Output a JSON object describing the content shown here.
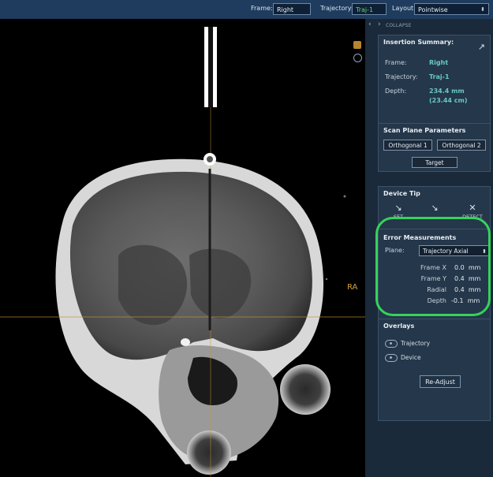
{
  "topbar": {
    "frame_label": "Frame:",
    "frame_value": "Right",
    "trajectory_label": "Trajectory:",
    "trajectory_value": "Traj-1",
    "layout_label": "Layout:",
    "layout_value": "Pointwise"
  },
  "viewer": {
    "orientation_label": "RA",
    "tools": [
      "settings-square-icon",
      "circle-target-icon"
    ]
  },
  "panel": {
    "collapse_label": "COLLAPSE",
    "insertion_summary": {
      "title": "Insertion Summary:",
      "rows": [
        {
          "key": "Frame:",
          "value": "Right"
        },
        {
          "key": "Trajectory:",
          "value": "Traj-1"
        },
        {
          "key": "Depth:",
          "value": "234.4 mm"
        }
      ],
      "depth_secondary": "(23.44 cm)"
    },
    "scan_plane": {
      "title": "Scan Plane Parameters",
      "buttons": [
        "Orthogonal 1",
        "Orthogonal 2"
      ],
      "target_label": "Target"
    },
    "device_tip": {
      "title": "Device Tip",
      "actions": [
        "SET",
        "",
        "DETECT"
      ]
    },
    "error_measurements": {
      "title": "Error Measurements",
      "plane_label": "Plane:",
      "plane_value": "Trajectory Axial",
      "rows": [
        {
          "key": "Frame X",
          "value": "0.0",
          "unit": "mm"
        },
        {
          "key": "Frame Y",
          "value": "0.4",
          "unit": "mm"
        },
        {
          "key": "Radial",
          "value": "0.4",
          "unit": "mm"
        },
        {
          "key": "Depth",
          "value": "-0.1",
          "unit": "mm"
        }
      ]
    },
    "overlays": {
      "title": "Overlays",
      "items": [
        "Trajectory",
        "Device"
      ],
      "readjust_label": "Re-Adjust"
    }
  },
  "colors": {
    "accent_teal": "#68c9c4",
    "highlight_green": "#35d35a",
    "orientation_orange": "#d6a33b"
  }
}
